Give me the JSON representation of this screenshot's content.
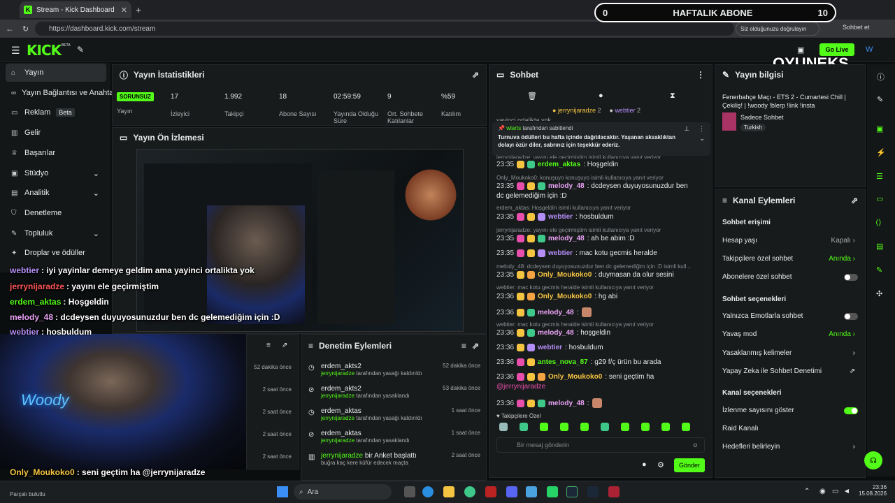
{
  "browser": {
    "tab_title": "Stream - Kick Dashboard",
    "url": "https://dashboard.kick.com/stream",
    "verify_label": "Siz olduğunuzu doğrulayın",
    "profile_label": "Sohbet et"
  },
  "overlay_goal": {
    "left": "0",
    "title": "HAFTALIK ABONE",
    "right": "10"
  },
  "topbar": {
    "beta": "BETA",
    "go_live": "Go Live"
  },
  "watermark": "OYUNEKS",
  "sidebar": {
    "items": [
      {
        "label": "Yayın"
      },
      {
        "label": "Yayın Bağlantısı ve Anahtar"
      },
      {
        "label": "Reklam",
        "badge": "Beta"
      },
      {
        "label": "Gelir"
      },
      {
        "label": "Başarılar"
      },
      {
        "label": "Stüdyo"
      },
      {
        "label": "Analitik"
      },
      {
        "label": "Denetleme"
      },
      {
        "label": "Topluluk"
      },
      {
        "label": "Droplar ve ödüller"
      }
    ]
  },
  "stats": {
    "title": "Yayın İstatistikleri",
    "status": "SORUNSUZ",
    "status_label": "Yayın",
    "items": [
      {
        "value": "17",
        "label": "İzleyici"
      },
      {
        "value": "1.992",
        "label": "Takipçi"
      },
      {
        "value": "18",
        "label": "Abone Sayısı"
      },
      {
        "value": "02:59:59",
        "label": "Yayında Olduğu Süre"
      },
      {
        "value": "9",
        "label": "Ort. Sohbete Katılanlar"
      },
      {
        "value": "%59",
        "label": "Katılım"
      }
    ]
  },
  "preview": {
    "title": "Yayın Ön İzlemesi"
  },
  "overlay_chat": [
    {
      "user": "webtier",
      "text": ": iyi yayinlar demeye geldim ama yayinci ortalikta yok"
    },
    {
      "user": "jerrynijaradze",
      "text": ": yayını ele geçirmiştim"
    },
    {
      "user": "erdem_aktas",
      "text": ": Hoşgeldin"
    },
    {
      "user": "melody_48",
      "text": ": dcdeysen duyuyosunuzdur ben dc gelemediğim için :D"
    },
    {
      "user": "webtier",
      "text": ": hosbuldum"
    },
    {
      "user": "Only_Moukoko0",
      "text": ": seni geçtim ha @jerrynijaradze"
    },
    {
      "user": "melody_48",
      "text": ": 🙇"
    }
  ],
  "cloud_status": "Parçalı bulutlu",
  "log": {
    "times": [
      "52 dakika önce",
      "2 saat önce",
      "2 saat önce",
      "2 saat önce",
      "2 saat önce"
    ]
  },
  "moderation": {
    "title": "Denetim Eylemleri",
    "items": [
      {
        "user": "erdem_akts2",
        "by": "jerrynijaradze",
        "action": "tarafından yasağı kaldırıldı",
        "time": "52 dakika önce"
      },
      {
        "user": "erdem_akts2",
        "by": "jerrynijaradze",
        "action": "tarafından yasaklandı",
        "time": "53 dakika önce"
      },
      {
        "user": "erdem_aktas",
        "by": "jerrynijaradze",
        "action": "tarafından yasağı kaldırıldı",
        "time": "1 saat önce"
      },
      {
        "user": "erdem_aktas",
        "by": "jerrynijaradze",
        "action": "tarafından yasaklandı",
        "time": "1 saat önce"
      },
      {
        "user": "jerrynijaradze",
        "by": "bir Anket başlattı",
        "action": "buğra kaç kere küfür edecek maçta",
        "time": "2 saat önce"
      }
    ]
  },
  "chat": {
    "title": "Sohbet",
    "top_gifters": [
      {
        "name": "jerrynijaradze",
        "count": "2"
      },
      {
        "name": "webtier",
        "count": "2"
      }
    ],
    "partial_top": "yayinci ortalikta yok",
    "pinned_by": "tarafından sabitlendi",
    "pinned_user": "wlarts",
    "pinned_text": "Turnuva ödülleri bu hafta içinde dağıtılacaktır. Yaşanan aksaklıktan dolayı özür diler, sabrınız için teşekkür ederiz.",
    "pinned_reply_hint": "jerrynijaradze: yayını ele geçirmiştim isimli kullanıcıya yanıt veriyor",
    "messages": [
      {
        "time": "23:35",
        "user": "erdem_aktas",
        "text": ": Hoşgeldin",
        "color": "#53fc18"
      },
      {
        "reply": "Only_Moukoko0: konuşuyo konuşuyo isimli kullanıcıya yanıt veriyor"
      },
      {
        "time": "23:35",
        "user": "melody_48",
        "text": ": dcdeysen duyuyosunuzdur ben",
        "text2": "dc gelemediğim için :D",
        "color": "#e9a3f5"
      },
      {
        "reply": "erdem_aktas: Hoşgeldin isimli kullanıcıya yanıt veriyor"
      },
      {
        "time": "23:35",
        "user": "webtier",
        "text": ": hosbuldum",
        "color": "#b48ef7"
      },
      {
        "reply": "jerrynijaradze: yayını ele geçirmiştim isimli kullanıcıya yanıt veriyor"
      },
      {
        "time": "23:35",
        "user": "melody_48",
        "text": ": ah be abim :D",
        "color": "#e9a3f5"
      },
      {
        "time": "23:35",
        "user": "webtier",
        "text": ": mac kotu gecmis heralde",
        "color": "#b48ef7"
      },
      {
        "reply": "melody_48: dcdeysen duyuyosunuzdur ben dc gelemediğim için :D isimli kull..."
      },
      {
        "time": "23:35",
        "user": "Only_Moukoko0",
        "text": ": duymasan da olur sesini",
        "color": "#f5c542"
      },
      {
        "reply": "webtier: mac kotu gecmis heralde isimli kullanıcıya yanıt veriyor"
      },
      {
        "time": "23:36",
        "user": "Only_Moukoko0",
        "text": ": hg abi",
        "color": "#f5c542"
      },
      {
        "time": "23:36",
        "user": "melody_48",
        "text": ":",
        "color": "#e9a3f5"
      },
      {
        "reply": "webtier: mac kotu gecmis heralde isimli kullanıcıya yanıt veriyor"
      },
      {
        "time": "23:36",
        "user": "melody_48",
        "text": ": hoşgeldin",
        "color": "#e9a3f5"
      },
      {
        "time": "23:36",
        "user": "webtier",
        "text": ": hosbuldum",
        "color": "#b48ef7"
      },
      {
        "time": "23:36",
        "user": "antes_nova_87",
        "text": ": g29 f/ç ürün bu arada",
        "color": "#53fc18"
      },
      {
        "time": "23:36",
        "user": "Only_Moukoko0",
        "text": ": seni geçtim ha",
        "text2": "@jerrynijaradze",
        "color": "#f5c542"
      },
      {
        "time": "23:36",
        "user": "melody_48",
        "text": ":",
        "color": "#e9a3f5"
      }
    ],
    "followers_only": "Takipçilere Özel",
    "input_placeholder": "Bir mesaj gönderin",
    "send_label": "Gönder"
  },
  "stream_info": {
    "title": "Yayın bilgisi",
    "stream_title": "Fenerbahçe Maçı - ETS 2 - Cumartesi Chill | Çekiliş! | !woody !blerp !link !insta",
    "category": "Sadece Sohbet",
    "tag": "Turkish"
  },
  "channel_actions": {
    "title": "Kanal Eylemleri",
    "chat_access": "Sohbet erişimi",
    "account_age": "Hesap yaşı",
    "account_age_value": "Kapalı",
    "followers_chat": "Takipçilere özel sohbet",
    "followers_chat_value": "Anında",
    "subscribers_chat": "Abonelere özel sohbet",
    "chat_options": "Sohbet seçenekleri",
    "emotes_only": "Yalnızca Emotlarla sohbet",
    "slow_mode": "Yavaş mod",
    "slow_mode_value": "Anında",
    "banned_words": "Yasaklanmış kelimeler",
    "ai_mod": "Yapay Zeka ile Sohbet Denetimi",
    "channel_options": "Kanal seçenekleri",
    "show_viewers": "İzlenme sayısını göster",
    "raid": "Raid Kanalı",
    "targets": "Hedefleri belirleyin"
  },
  "taskbar": {
    "search": "Ara",
    "time": "23:36",
    "date": "15.08.2026"
  },
  "colors": {
    "accent": "#53fc18",
    "bg": "#0b0e0f",
    "panel": "#181b1c"
  }
}
